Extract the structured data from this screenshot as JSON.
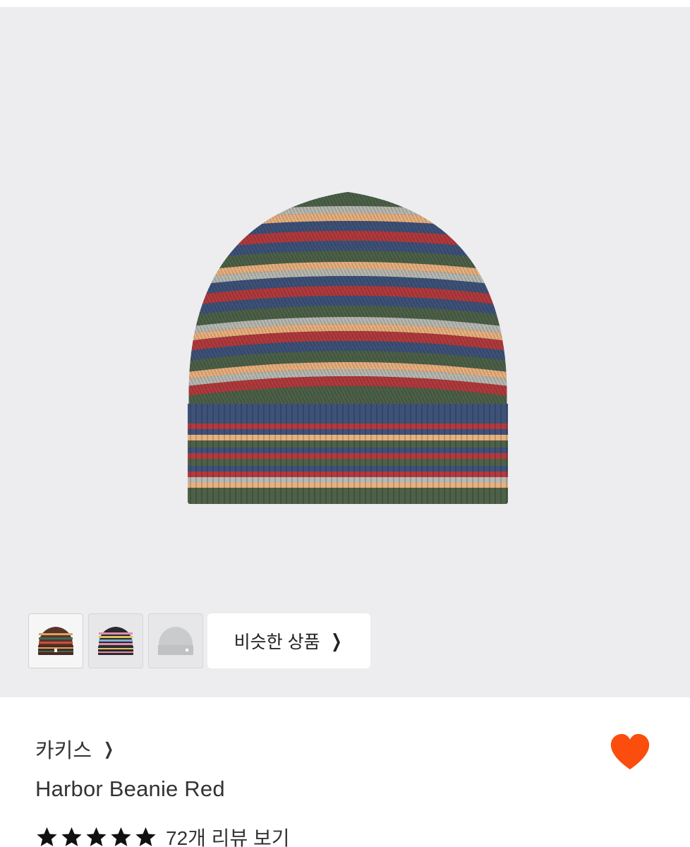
{
  "gallery": {
    "thumbnails": [
      {
        "name": "thumbnail-1",
        "selected": true
      },
      {
        "name": "thumbnail-2",
        "selected": false
      },
      {
        "name": "thumbnail-3",
        "selected": false
      }
    ],
    "similar_button_label": "비슷한 상품",
    "similar_button_icon": "chevron-right-icon"
  },
  "product": {
    "brand": "카키스",
    "brand_icon": "chevron-right-icon",
    "name": "Harbor Beanie Red",
    "rating_stars": 5,
    "review_link": "72개 리뷰 보기",
    "favorite_icon": "heart-icon"
  },
  "colors": {
    "hero_background": "#ededef",
    "heart": "#fb4d0d",
    "stripe_navy": "#3e5279",
    "stripe_green": "#4d6148",
    "stripe_red": "#b23a3d",
    "stripe_peach": "#e9b07e",
    "stripe_gray": "#b7b9b1"
  }
}
